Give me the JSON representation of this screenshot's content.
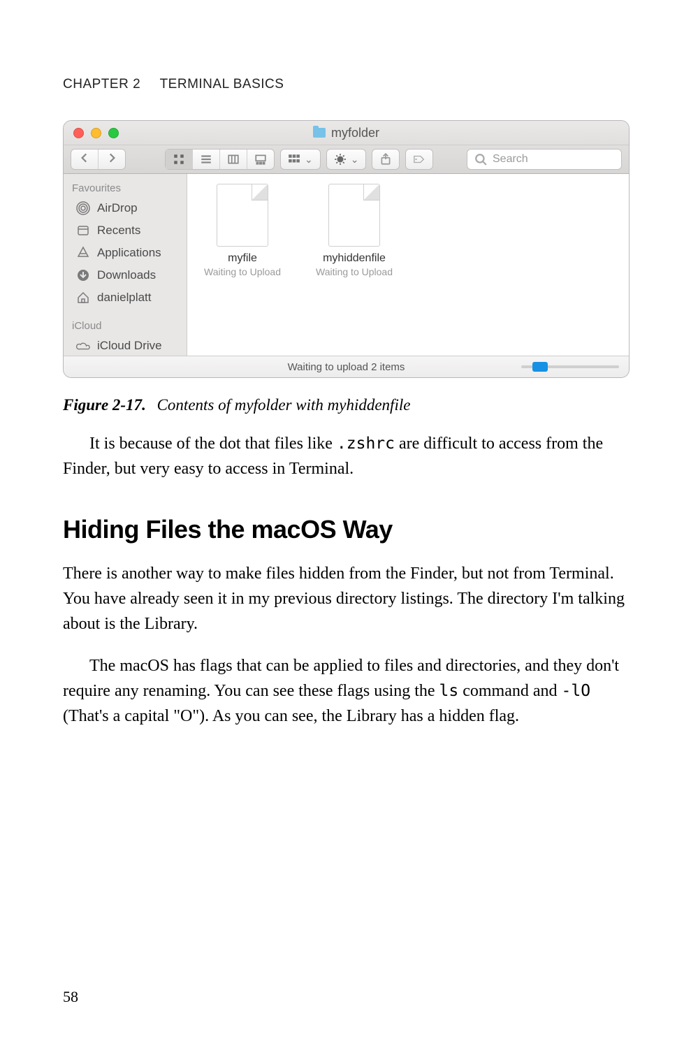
{
  "running_head": {
    "chapter": "CHAPTER 2",
    "title": "TERMINAL BASICS"
  },
  "finder": {
    "window_title": "myfolder",
    "search_placeholder": "Search",
    "sidebar": {
      "section1": "Favourites",
      "items": [
        {
          "label": "AirDrop"
        },
        {
          "label": "Recents"
        },
        {
          "label": "Applications"
        },
        {
          "label": "Downloads"
        },
        {
          "label": "danielplatt"
        }
      ],
      "section2": "iCloud",
      "icloud_item": "iCloud Drive"
    },
    "files": [
      {
        "name": "myfile",
        "status": "Waiting to Upload"
      },
      {
        "name": "myhiddenfile",
        "status": "Waiting to Upload"
      }
    ],
    "statusbar": "Waiting to upload 2 items"
  },
  "caption": {
    "label": "Figure 2-17.",
    "text": "Contents of myfolder with myhiddenfile"
  },
  "body": {
    "p1a": "It is because of the dot that files like ",
    "p1_code": ".zshrc",
    "p1b": " are difficult to access from the Finder, but very easy to access in Terminal.",
    "heading": "Hiding Files the macOS Way",
    "p2": "There is another way to make files hidden from the Finder, but not from Terminal. You have already seen it in my previous directory listings. The directory I'm talking about is the Library.",
    "p3a": "The macOS has flags that can be applied to files and directories, and they don't require any renaming. You can see these flags using the ",
    "p3_code1": "ls",
    "p3b": " command and ",
    "p3_code2": "-lO",
    "p3c": " (That's a capital \"O\"). As you can see, the Library has a hidden flag."
  },
  "page_number": "58"
}
